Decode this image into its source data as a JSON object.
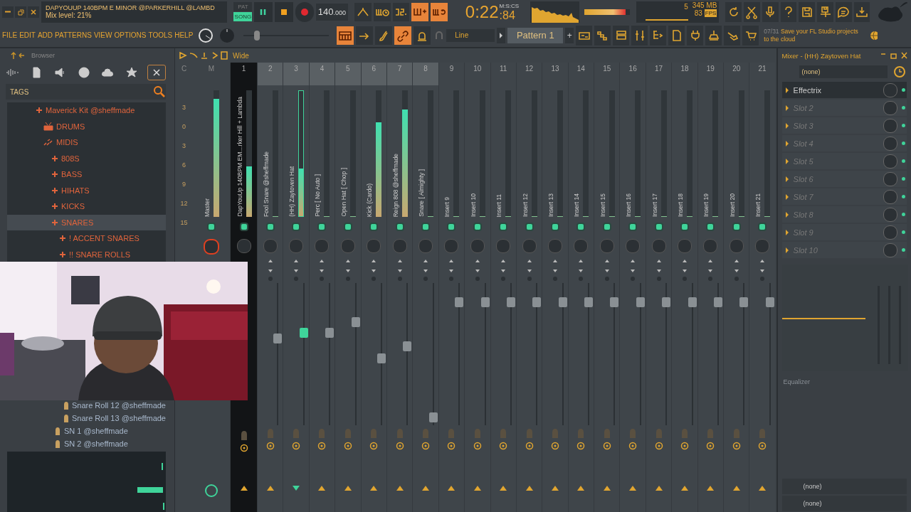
{
  "title_bar": {
    "project": "DAPYOUUP 140BPM E MINOR @PARKERHILL @LAMBD",
    "hint": "Mix level: 21%"
  },
  "transport": {
    "modes": [
      {
        "label": "PAT",
        "selected": false
      },
      {
        "label": "SONG",
        "selected": true
      }
    ],
    "tempo": "140",
    "tempo_decimals": ".000",
    "time": "0:22",
    "time_cs": ":84",
    "time_unit": "M:S:CS"
  },
  "monitor": {
    "volume": {
      "level": 0.9
    },
    "cpu": "5",
    "memory": "345 MB",
    "fps": "83",
    "fps_label": "FPS"
  },
  "pitch": {
    "level": 0.13
  },
  "menu": [
    "FILE",
    "EDIT",
    "ADD",
    "PATTERNS",
    "VIEW",
    "OPTIONS",
    "TOOLS",
    "HELP"
  ],
  "snap": "Line",
  "pattern": "Pattern 1",
  "pattern_add": "+",
  "news": {
    "counter": "07/31",
    "text": "Save your FL Studio projects to the cloud"
  },
  "browser": {
    "title": "Browser",
    "tags_label": "TAGS",
    "tree": [
      {
        "label": "Maverick Kit @sheffmade",
        "kind": "folder",
        "selected": false,
        "children": [
          {
            "label": "DRUMS",
            "kind": "drums",
            "selected": false
          },
          {
            "label": "MIDIS",
            "kind": "midis",
            "selected": false,
            "children": [
              {
                "label": "808S",
                "kind": "folder",
                "selected": false
              },
              {
                "label": "BASS",
                "kind": "folder",
                "selected": false
              },
              {
                "label": "HIHATS",
                "kind": "folder",
                "selected": false
              },
              {
                "label": "KICKS",
                "kind": "folder",
                "selected": false
              },
              {
                "label": "SNARES",
                "kind": "folder",
                "selected": true,
                "children": [
                  {
                    "label": "! ACCENT SNARES",
                    "kind": "folder",
                    "selected": false
                  },
                  {
                    "label": "!! SNARE ROLLS",
                    "kind": "folder",
                    "selected": false,
                    "children": [
                      {
                        "label": "Snare Roll 12 @sheffmade",
                        "kind": "file",
                        "selected": false
                      },
                      {
                        "label": "Snare Roll 13 @sheffmade",
                        "kind": "file",
                        "selected": false
                      }
                    ]
                  },
                  {
                    "label": "SN 1 @sheffmade",
                    "kind": "file",
                    "selected": false
                  },
                  {
                    "label": "SN 2 @sheffmade",
                    "kind": "file",
                    "selected": false
                  }
                ]
              }
            ]
          }
        ]
      }
    ]
  },
  "mixer": {
    "view": "Wide",
    "scale_header": "C",
    "scale": [
      "3",
      "0",
      "3",
      "6",
      "9",
      "12",
      "15"
    ],
    "master": {
      "header": "M",
      "name": "Master",
      "meter": {
        "level": 0.93
      }
    },
    "tracks": [
      {
        "number": "1",
        "name": "DapYouUp 140BPM EM…rker Hill + Lambda",
        "dark": true,
        "highlighted": false,
        "selected": false,
        "meter": {
          "level": 0.4
        }
      },
      {
        "number": "2",
        "name": "Fool Snare @sheffmade",
        "dark": false,
        "highlighted": true,
        "selected": false,
        "meter": {
          "level": 0
        },
        "fader": {
          "level": 0.62
        }
      },
      {
        "number": "3",
        "name": "(HH) Zaytoven Hat",
        "dark": false,
        "highlighted": true,
        "selected": true,
        "meter": {
          "level": 0.38
        },
        "fader": {
          "level": 0.66
        }
      },
      {
        "number": "4",
        "name": "Perc [ No Auto ]",
        "dark": false,
        "highlighted": true,
        "selected": false,
        "meter": {
          "level": 0
        },
        "fader": {
          "level": 0.66
        }
      },
      {
        "number": "5",
        "name": "Open Hat [ Chop ]",
        "dark": false,
        "highlighted": true,
        "selected": false,
        "meter": {
          "level": 0
        },
        "fader": {
          "level": 0.74
        }
      },
      {
        "number": "6",
        "name": "Kick (Cardo)",
        "dark": false,
        "highlighted": true,
        "selected": false,
        "meter": {
          "level": 0.75
        },
        "fader": {
          "level": 0.47
        }
      },
      {
        "number": "7",
        "name": "Reign 808 @sheffmade",
        "dark": false,
        "highlighted": true,
        "selected": false,
        "meter": {
          "level": 0.85
        },
        "fader": {
          "level": 0.56
        }
      },
      {
        "number": "8",
        "name": "Snare [ Almighty ]",
        "dark": false,
        "highlighted": true,
        "selected": false,
        "meter": {
          "level": 0
        },
        "fader": {
          "level": 0.02
        }
      },
      {
        "number": "9",
        "name": "Insert 9",
        "dark": false,
        "highlighted": false,
        "selected": false,
        "meter": {
          "level": 0
        },
        "fader": {
          "level": 0.89
        }
      },
      {
        "number": "10",
        "name": "Insert 10",
        "dark": false,
        "highlighted": false,
        "selected": false,
        "meter": {
          "level": 0
        },
        "fader": {
          "level": 0.89
        }
      },
      {
        "number": "11",
        "name": "Insert 11",
        "dark": false,
        "highlighted": false,
        "selected": false,
        "meter": {
          "level": 0
        },
        "fader": {
          "level": 0.89
        }
      },
      {
        "number": "12",
        "name": "Insert 12",
        "dark": false,
        "highlighted": false,
        "selected": false,
        "meter": {
          "level": 0
        },
        "fader": {
          "level": 0.89
        }
      },
      {
        "number": "13",
        "name": "Insert 13",
        "dark": false,
        "highlighted": false,
        "selected": false,
        "meter": {
          "level": 0
        },
        "fader": {
          "level": 0.89
        }
      },
      {
        "number": "14",
        "name": "Insert 14",
        "dark": false,
        "highlighted": false,
        "selected": false,
        "meter": {
          "level": 0
        },
        "fader": {
          "level": 0.89
        }
      },
      {
        "number": "15",
        "name": "Insert 15",
        "dark": false,
        "highlighted": false,
        "selected": false,
        "meter": {
          "level": 0
        },
        "fader": {
          "level": 0.89
        }
      },
      {
        "number": "16",
        "name": "Insert 16",
        "dark": false,
        "highlighted": false,
        "selected": false,
        "meter": {
          "level": 0
        },
        "fader": {
          "level": 0.89
        }
      },
      {
        "number": "17",
        "name": "Insert 17",
        "dark": false,
        "highlighted": false,
        "selected": false,
        "meter": {
          "level": 0
        },
        "fader": {
          "level": 0.89
        }
      },
      {
        "number": "18",
        "name": "Insert 18",
        "dark": false,
        "highlighted": false,
        "selected": false,
        "meter": {
          "level": 0
        },
        "fader": {
          "level": 0.89
        }
      },
      {
        "number": "19",
        "name": "Insert 19",
        "dark": false,
        "highlighted": false,
        "selected": false,
        "meter": {
          "level": 0
        },
        "fader": {
          "level": 0.89
        }
      },
      {
        "number": "20",
        "name": "Insert 20",
        "dark": false,
        "highlighted": false,
        "selected": false,
        "meter": {
          "level": 0
        },
        "fader": {
          "level": 0.89
        }
      },
      {
        "number": "21",
        "name": "Insert 21",
        "dark": false,
        "highlighted": false,
        "selected": false,
        "meter": {
          "level": 0
        },
        "fader": {
          "level": 0.89
        }
      }
    ]
  },
  "fx_panel": {
    "title": "Mixer - (HH) Zaytoven Hat",
    "preset": "(none)",
    "slots": [
      {
        "label": "Effectrix",
        "on": true
      },
      {
        "label": "Slot 2",
        "on": false
      },
      {
        "label": "Slot 3",
        "on": false
      },
      {
        "label": "Slot 4",
        "on": false
      },
      {
        "label": "Slot 5",
        "on": false
      },
      {
        "label": "Slot 6",
        "on": false
      },
      {
        "label": "Slot 7",
        "on": false
      },
      {
        "label": "Slot 8",
        "on": false
      },
      {
        "label": "Slot 9",
        "on": false
      },
      {
        "label": "Slot 10",
        "on": false
      }
    ],
    "eq_label": "Equalizer",
    "inputs": [
      "(none)",
      "(none)"
    ]
  }
}
